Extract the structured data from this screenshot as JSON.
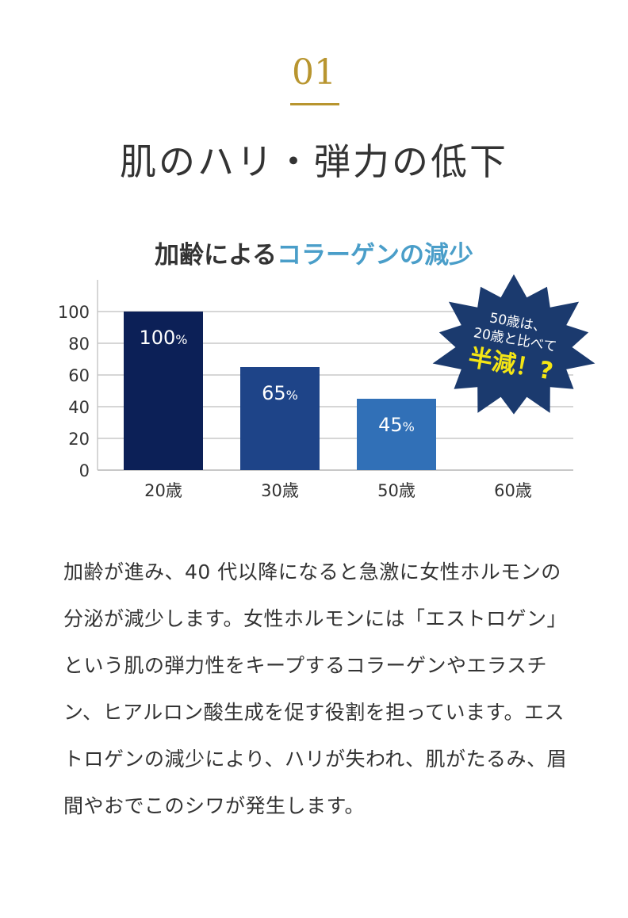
{
  "section_number": "01",
  "heading": "肌のハリ・弾力の低下",
  "chart_data": {
    "type": "bar",
    "title_part1": "加齢による",
    "title_part2": "コラーゲンの減少",
    "categories": [
      "20歳",
      "30歳",
      "50歳",
      "60歳"
    ],
    "values": [
      100,
      65,
      45,
      null
    ],
    "data_labels": [
      "100",
      "65",
      "45",
      ""
    ],
    "label_unit": "%",
    "bar_colors": [
      "#0c2057",
      "#1e4488",
      "#3170b7",
      null
    ],
    "yticks": [
      0,
      20,
      40,
      60,
      80,
      100
    ],
    "ylim": [
      0,
      120
    ],
    "grid": true,
    "callout": {
      "line1": "50歳は、",
      "line2": "20歳と比べて",
      "emphasis": "半減！?",
      "bg_color": "#1b3a6e",
      "emphasis_color": "#f5e614"
    }
  },
  "body_text": "加齢が進み、40 代以降になると急激に女性ホルモンの分泌が減少します。女性ホルモンには「エストロゲン」という肌の弾力性をキープするコラーゲンやエラスチン、ヒアルロン酸生成を促す役割を担っています。エストロゲンの減少により、ハリが失われ、肌がたるみ、眉間やおでこのシワが発生します。"
}
